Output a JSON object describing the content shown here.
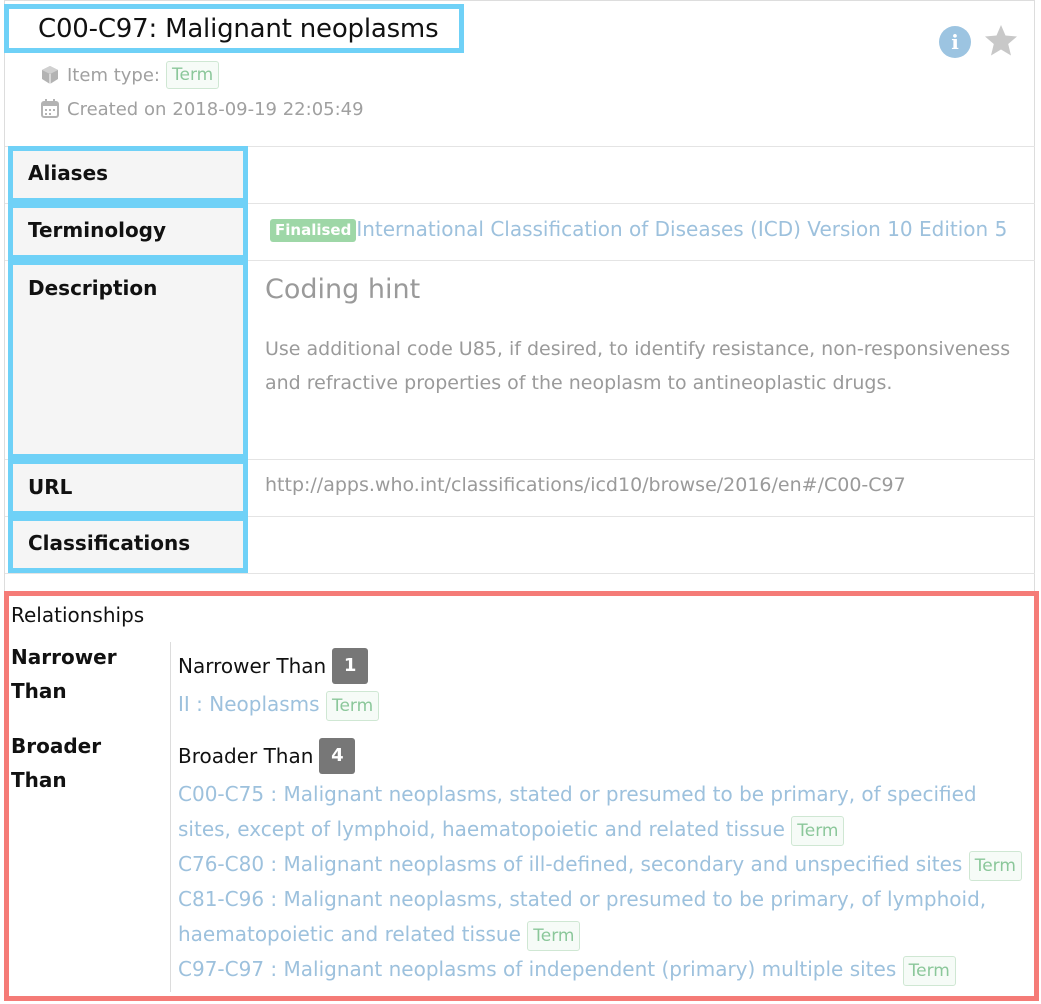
{
  "header": {
    "title": "C00-C97: Malignant neoplasms",
    "item_type_label": "Item type:",
    "item_type": "Term",
    "created_label": "Created on",
    "created_value": "2018-09-19 22:05:49"
  },
  "properties": {
    "aliases_label": "Aliases",
    "terminology_label": "Terminology",
    "terminology_status": "Finalised",
    "terminology_value": "International Classification of Diseases (ICD) Version 10 Edition 5",
    "description_label": "Description",
    "description_heading": "Coding hint",
    "description_text": "Use additional code U85, if desired, to identify resistance, non-responsiveness and refractive properties of the neoplasm to antineoplastic drugs.",
    "url_label": "URL",
    "url_value": "http://apps.who.int/classifications/icd10/browse/2016/en#/C00-C97",
    "classifications_label": "Classifications"
  },
  "relationships": {
    "title": "Relationships",
    "narrower_label": "Narrower Than",
    "narrower_heading": "Narrower Than",
    "narrower_count": "1",
    "narrower_items": [
      {
        "text": "II : Neoplasms",
        "badge": "Term"
      }
    ],
    "broader_label": "Broader Than",
    "broader_heading": "Broader Than",
    "broader_count": "4",
    "broader_items": [
      {
        "text": "C00-C75 : Malignant neoplasms, stated or presumed to be primary, of specified sites, except of lymphoid, haematopoietic and related tissue",
        "badge": "Term"
      },
      {
        "text": "C76-C80 : Malignant neoplasms of ill-defined, secondary and unspecified sites",
        "badge": "Term"
      },
      {
        "text": "C81-C96 : Malignant neoplasms, stated or presumed to be primary, of lymphoid, haematopoietic and related tissue",
        "badge": "Term"
      },
      {
        "text": "C97-C97 : Malignant neoplasms of independent (primary) multiple sites",
        "badge": "Term"
      }
    ]
  },
  "icons": {
    "info": "info-icon",
    "favourite": "star-icon",
    "item_type": "cube-icon",
    "created": "calendar-icon"
  },
  "colors": {
    "link": "#9dc1dd",
    "term_badge": "#8bc79a",
    "finalised_badge": "#9ed7a7",
    "count_badge": "#777777",
    "highlight_blue": "#6fd1f7",
    "highlight_red": "#f57b77"
  }
}
